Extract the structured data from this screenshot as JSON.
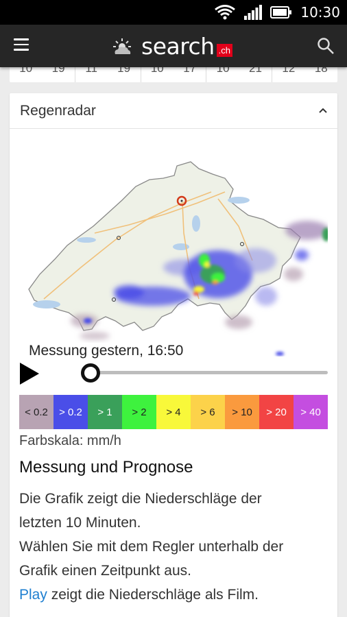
{
  "status_bar": {
    "time": "10:30",
    "icons": [
      "wifi-icon",
      "signal-icon",
      "battery-icon"
    ]
  },
  "app_bar": {
    "menu_icon": "hamburger-menu-icon",
    "logo_icon": "sun-cloud-icon",
    "brand_word": "search",
    "brand_suffix": ".ch",
    "brand_color": "#e2001a",
    "search_icon": "search-icon"
  },
  "previous_card": {
    "cells": [
      [
        "10",
        "19"
      ],
      [
        "11",
        "19"
      ],
      [
        "10",
        "17"
      ],
      [
        "10",
        "21"
      ],
      [
        "12",
        "18"
      ]
    ]
  },
  "radar": {
    "title": "Regenradar",
    "collapse_icon": "chevron-up-icon",
    "timestamp": "Messung gestern, 16:50",
    "slider_value": 0,
    "color_scale": [
      {
        "label": "< 0.2",
        "color": "#b8a3b3",
        "text_color": "#222"
      },
      {
        "label": "> 0.2",
        "color": "#4a4ee8",
        "text_color": "#fff"
      },
      {
        "label": "> 1",
        "color": "#3aa05a",
        "text_color": "#fff"
      },
      {
        "label": "> 2",
        "color": "#3ef23e",
        "text_color": "#222"
      },
      {
        "label": "> 4",
        "color": "#f8f83a",
        "text_color": "#222"
      },
      {
        "label": "> 6",
        "color": "#fcd24a",
        "text_color": "#222"
      },
      {
        "label": "> 10",
        "color": "#fa9a3e",
        "text_color": "#222"
      },
      {
        "label": "> 20",
        "color": "#f24444",
        "text_color": "#fff"
      },
      {
        "label": "> 40",
        "color": "#c44ee0",
        "text_color": "#fff"
      }
    ],
    "unit_label": "Farbskala: mm/h",
    "section_heading": "Messung und Prognose",
    "description": {
      "line1": "Die Grafik zeigt die Niederschläge der",
      "line2": "letzten 10 Minuten.",
      "line3": "Wählen Sie mit dem Regler unterhalb der",
      "line4": "Grafik einen Zeitpunkt aus.",
      "play_link": "Play",
      "line5_rest": " zeigt die Niederschläge als Film."
    }
  }
}
